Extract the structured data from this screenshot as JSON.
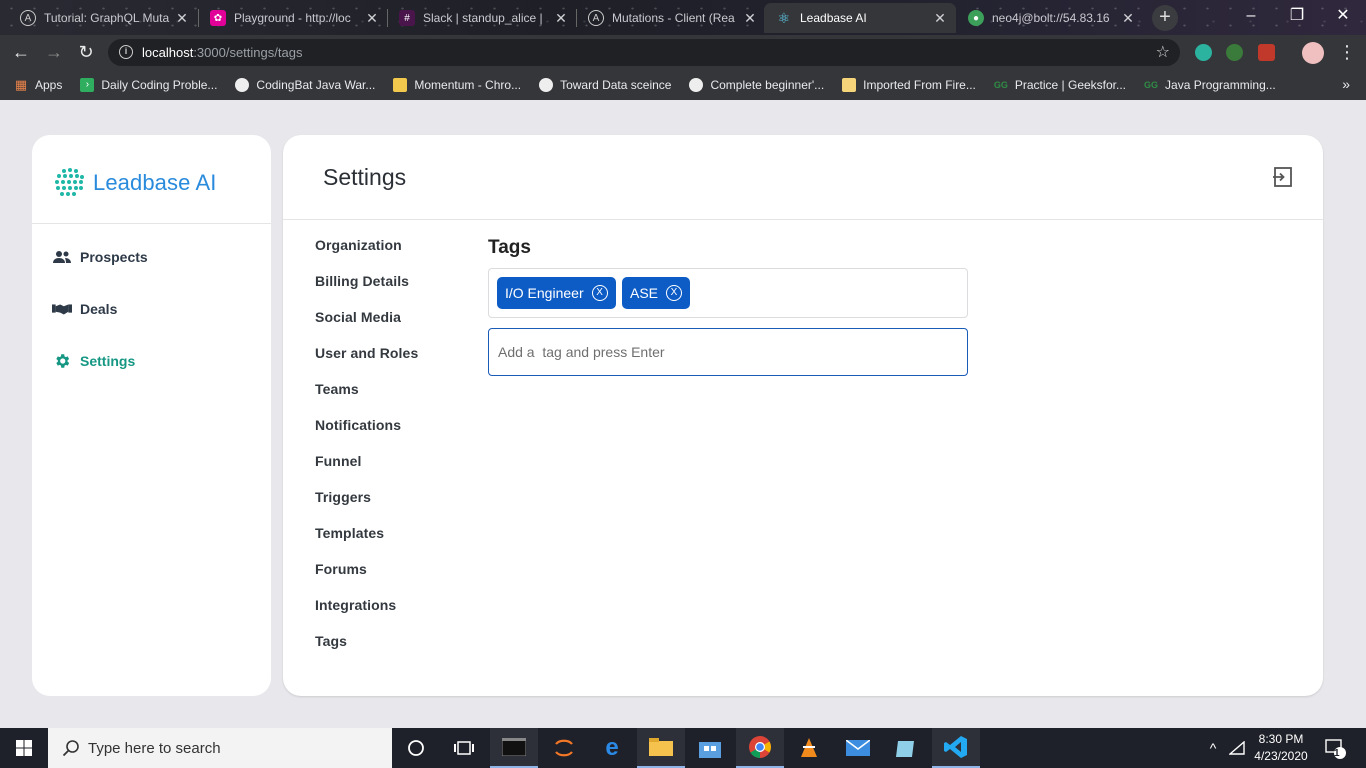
{
  "browser": {
    "tabs": [
      {
        "label": "Tutorial: GraphQL Muta",
        "favicon": "apollo-icon"
      },
      {
        "label": "Playground - http://loc",
        "favicon": "graphql-icon"
      },
      {
        "label": "Slack | standup_alice | ",
        "favicon": "slack-icon"
      },
      {
        "label": "Mutations - Client (Rea",
        "favicon": "apollo-icon"
      },
      {
        "label": "Leadbase AI",
        "favicon": "react-icon"
      },
      {
        "label": "neo4j@bolt://54.83.16",
        "favicon": "globe-icon"
      }
    ],
    "active_tab": 4,
    "url_host": "localhost",
    "url_path": ":3000/settings/tags"
  },
  "bookmarks": [
    {
      "label": "Apps",
      "icon": "apps-grid-icon"
    },
    {
      "label": "Daily Coding Proble...",
      "icon": "bookmark-green-icon"
    },
    {
      "label": "CodingBat Java War...",
      "icon": "globe-icon"
    },
    {
      "label": "Momentum - Chro...",
      "icon": "momentum-icon"
    },
    {
      "label": "Toward Data sceince",
      "icon": "globe-icon"
    },
    {
      "label": "Complete beginner'...",
      "icon": "globe-icon"
    },
    {
      "label": "Imported From Fire...",
      "icon": "folder-icon"
    },
    {
      "label": "Practice | Geeksfor...",
      "icon": "gfg-icon"
    },
    {
      "label": "Java Programming...",
      "icon": "gfg-icon"
    }
  ],
  "sidebar": {
    "brand": "Leadbase AI",
    "items": [
      {
        "label": "Prospects",
        "icon": "people-icon",
        "active": false
      },
      {
        "label": "Deals",
        "icon": "handshake-icon",
        "active": false
      },
      {
        "label": "Settings",
        "icon": "gear-icon",
        "active": true
      }
    ]
  },
  "main": {
    "title": "Settings",
    "settings_menu": [
      "Organization",
      "Billing Details",
      "Social Media",
      "User and Roles",
      "Teams",
      "Notifications",
      "Funnel",
      "Triggers",
      "Templates",
      "Forums",
      "Integrations",
      "Tags"
    ],
    "tags_section": {
      "title": "Tags",
      "tags": [
        "I/O Engineer",
        "ASE"
      ],
      "remove_label": "X",
      "input_placeholder": "Add a  tag and press Enter"
    }
  },
  "taskbar": {
    "search_placeholder": "Type here to search",
    "time": "8:30 PM",
    "date": "4/23/2020",
    "notification_count": "1"
  },
  "colors": {
    "brand": "#2a8bdc",
    "active_nav": "#159783",
    "chip": "#0d5cc6",
    "input_border": "#1a5bb8"
  }
}
